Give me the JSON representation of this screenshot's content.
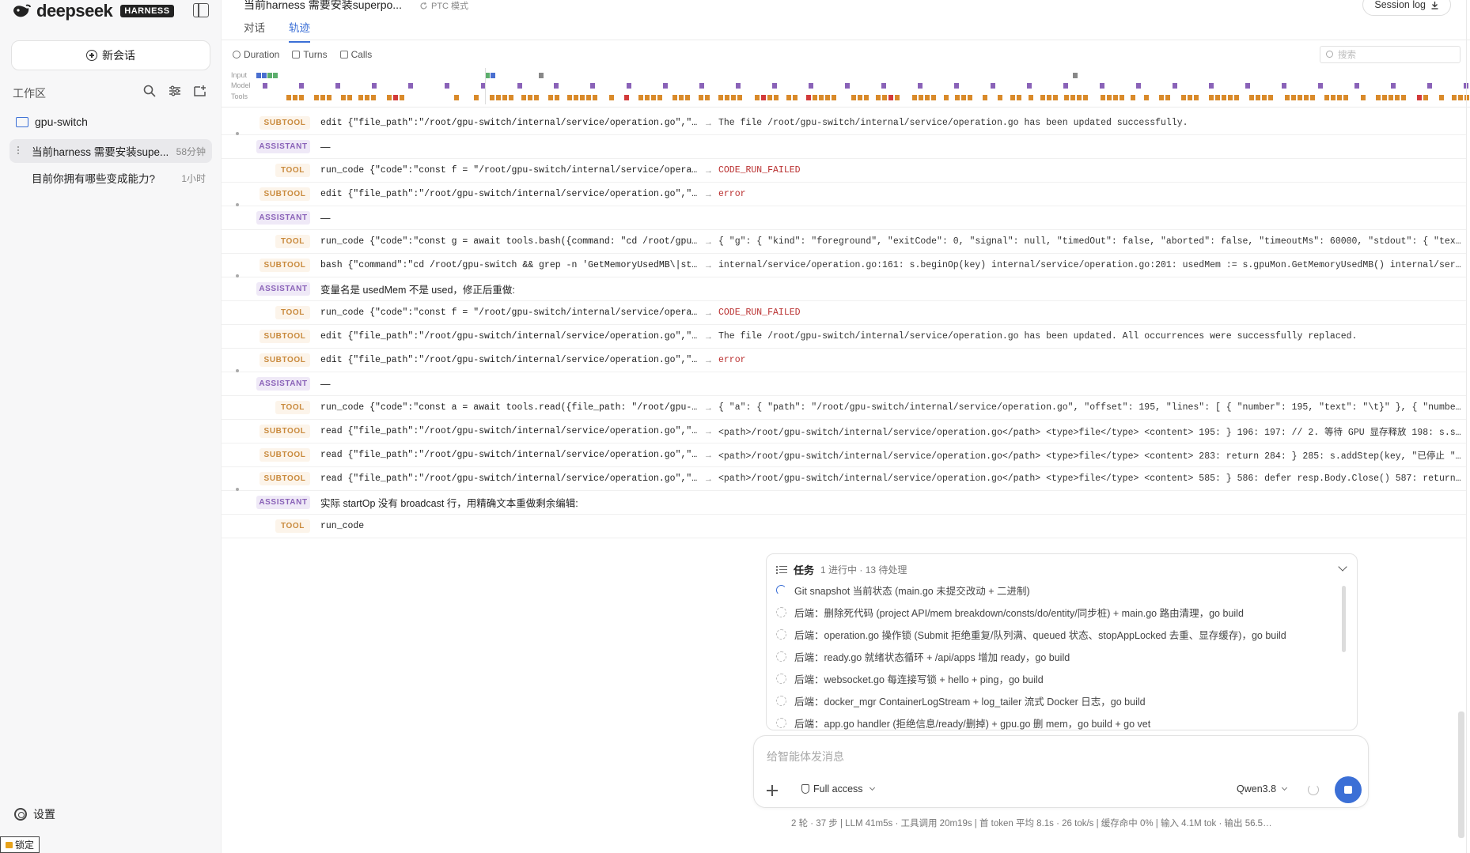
{
  "brand": {
    "name": "deepseek",
    "badge": "HARNESS"
  },
  "sidebar": {
    "new_chat": "新会话",
    "workspace_label": "工作区",
    "folder": "gpu-switch",
    "sessions": [
      {
        "title": "当前harness 需要安装supe...",
        "time": "58分钟",
        "active": true
      },
      {
        "title": "目前你拥有哪些变成能力?",
        "time": "1小时",
        "active": false
      }
    ],
    "settings": "设置",
    "lock": "锁定"
  },
  "header": {
    "title": "当前harness 需要安装superpo...",
    "mode": "PTC 模式",
    "session_log": "Session log",
    "tabs": [
      {
        "label": "对话",
        "active": false
      },
      {
        "label": "轨迹",
        "active": true
      }
    ]
  },
  "toolbar": {
    "duration": "Duration",
    "turns": "Turns",
    "calls": "Calls",
    "search_placeholder": "搜索"
  },
  "timeline": {
    "labels": [
      "Input",
      "Model",
      "Tools"
    ],
    "colors": {
      "input": "#4a6fd0",
      "input2": "#5cae6d",
      "model": "#8a62b8",
      "tool": "#d98a2a",
      "error": "#d23a3a"
    }
  },
  "trace": [
    {
      "kind": "SUBTOOL",
      "call": "edit {\"file_path\":\"/root/gpu-switch/internal/service/operation.go\",\"old…",
      "result": "The file /root/gpu-switch/internal/service/operation.go has been updated successfully.",
      "error": false
    },
    {
      "kind": "ASSISTANT",
      "msg": "—"
    },
    {
      "kind": "TOOL",
      "call": "run_code {\"code\":\"const f = \"/root/gpu-switch/internal/service/operatio…",
      "result": "CODE_RUN_FAILED",
      "error": true
    },
    {
      "kind": "SUBTOOL",
      "call": "edit {\"file_path\":\"/root/gpu-switch/internal/service/operation.go\",\"old…",
      "result": "error",
      "error": true
    },
    {
      "kind": "ASSISTANT",
      "msg": "—"
    },
    {
      "kind": "TOOL",
      "call": "run_code {\"code\":\"const g = await tools.bash({command: \"cd /root/gpu-sw…",
      "result": "{ \"g\": { \"kind\": \"foreground\", \"exitCode\": 0, \"signal\": null, \"timedOut\": false, \"aborted\": false, \"timeoutMs\": 60000, \"stdout\": { \"text\": …",
      "error": false
    },
    {
      "kind": "SUBTOOL",
      "call": "bash {\"command\":\"cd /root/gpu-switch && grep -n 'GetMemoryUsedMB\\|start…",
      "result": "internal/service/operation.go:161: s.beginOp(key) internal/service/operation.go:201: usedMem := s.gpuMon.GetMemoryUsedMB() internal/service…",
      "error": false
    },
    {
      "kind": "ASSISTANT",
      "msg": "变量名是 usedMem 不是 used，修正后重做:"
    },
    {
      "kind": "TOOL",
      "call": "run_code {\"code\":\"const f = \"/root/gpu-switch/internal/service/operatio…",
      "result": "CODE_RUN_FAILED",
      "error": true
    },
    {
      "kind": "SUBTOOL",
      "call": "edit {\"file_path\":\"/root/gpu-switch/internal/service/operation.go\",\"old…",
      "result": "The file /root/gpu-switch/internal/service/operation.go has been updated. All occurrences were successfully replaced.",
      "error": false
    },
    {
      "kind": "SUBTOOL",
      "call": "edit {\"file_path\":\"/root/gpu-switch/internal/service/operation.go\",\"old…",
      "result": "error",
      "error": true
    },
    {
      "kind": "ASSISTANT",
      "msg": "—"
    },
    {
      "kind": "TOOL",
      "call": "run_code {\"code\":\"const a = await tools.read({file_path: \"/root/gpu-swi…",
      "result": "{ \"a\": { \"path\": \"/root/gpu-switch/internal/service/operation.go\", \"offset\": 195, \"lines\": [ { \"number\": 195, \"text\": \"\\t}\" }, { \"number\": …",
      "error": false
    },
    {
      "kind": "SUBTOOL",
      "call": "read {\"file_path\":\"/root/gpu-switch/internal/service/operation.go\",\"off…",
      "result": "<path>/root/gpu-switch/internal/service/operation.go</path> <type>file</type> <content> 195: } 196: 197: // 2. 等待 GPU 显存释放 198: s.setS…",
      "error": false
    },
    {
      "kind": "SUBTOOL",
      "call": "read {\"file_path\":\"/root/gpu-switch/internal/service/operation.go\",\"off…",
      "result": "<path>/root/gpu-switch/internal/service/operation.go</path> <type>file</type> <content> 283: return 284: } 285: s.addStep(key, \"已停止 \"+ap…",
      "error": false
    },
    {
      "kind": "SUBTOOL",
      "call": "read {\"file_path\":\"/root/gpu-switch/internal/service/operation.go\",\"off…",
      "result": "<path>/root/gpu-switch/internal/service/operation.go</path> <type>file</type> <content> 585: } 586: defer resp.Body.Close() 587: return res…",
      "error": false
    },
    {
      "kind": "ASSISTANT",
      "msg": "实际 startOp 没有 broadcast 行，用精确文本重做剩余编辑:"
    },
    {
      "kind": "TOOL",
      "call": "run_code",
      "result": "",
      "error": false
    }
  ],
  "tasks": {
    "title": "任务",
    "meta": "1 进行中 · 13 待处理",
    "items": [
      {
        "text": "Git snapshot 当前状态 (main.go 未提交改动 + 二进制)",
        "active": true
      },
      {
        "text": "后端：删除死代码 (project API/mem breakdown/consts/do/entity/同步桩) + main.go 路由清理，go build",
        "active": false
      },
      {
        "text": "后端：operation.go 操作锁 (Submit 拒绝重复/队列满、queued 状态、stopAppLocked 去重、显存缓存)，go build",
        "active": false
      },
      {
        "text": "后端：ready.go 就绪状态循环 + /api/apps 增加 ready，go build",
        "active": false
      },
      {
        "text": "后端：websocket.go 每连接写锁 + hello + ping，go build",
        "active": false
      },
      {
        "text": "后端：docker_mgr ContainerLogStream + log_tailer 流式 Docker 日志，go build",
        "active": false
      },
      {
        "text": "后端：app.go handler (拒绝信息/ready/删掉) + gpu.go 删 mem，go build + go vet",
        "active": false
      }
    ]
  },
  "composer": {
    "placeholder": "给智能体发消息",
    "access": "Full access",
    "model": "Qwen3.8"
  },
  "status": "2 轮 · 37 步   |   LLM 41m5s · 工具调用 20m19s   |   首 token 平均 8.1s · 26 tok/s   |   缓存命中 0%   |   输入 4.1M tok · 输出 56.5…"
}
